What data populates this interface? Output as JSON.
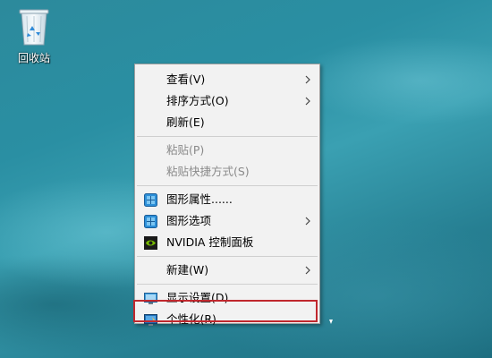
{
  "desktop": {
    "icons": [
      {
        "label": "回收站",
        "icon": "recycle-bin-icon"
      }
    ]
  },
  "context_menu": {
    "groups": [
      [
        {
          "label": "查看(V)",
          "submenu": true,
          "disabled": false
        },
        {
          "label": "排序方式(O)",
          "submenu": true,
          "disabled": false
        },
        {
          "label": "刷新(E)",
          "submenu": false,
          "disabled": false
        }
      ],
      [
        {
          "label": "粘贴(P)",
          "submenu": false,
          "disabled": true
        },
        {
          "label": "粘贴快捷方式(S)",
          "submenu": false,
          "disabled": true
        }
      ],
      [
        {
          "label": "图形属性......",
          "icon": "intel-graphics-icon",
          "submenu": false,
          "disabled": false
        },
        {
          "label": "图形选项",
          "icon": "intel-graphics-icon",
          "submenu": true,
          "disabled": false
        },
        {
          "label": "NVIDIA 控制面板",
          "icon": "nvidia-icon",
          "submenu": false,
          "disabled": false
        }
      ],
      [
        {
          "label": "新建(W)",
          "submenu": true,
          "disabled": false
        }
      ],
      [
        {
          "label": "显示设置(D)",
          "icon": "display-settings-icon",
          "submenu": false,
          "disabled": false
        },
        {
          "label": "个性化(R)",
          "icon": "personalize-icon",
          "submenu": false,
          "disabled": false,
          "highlighted": true
        }
      ]
    ]
  },
  "colors": {
    "menu_background": "#f2f2f2",
    "highlight_border": "#c0282e",
    "disabled_text": "#8a8a8a"
  }
}
